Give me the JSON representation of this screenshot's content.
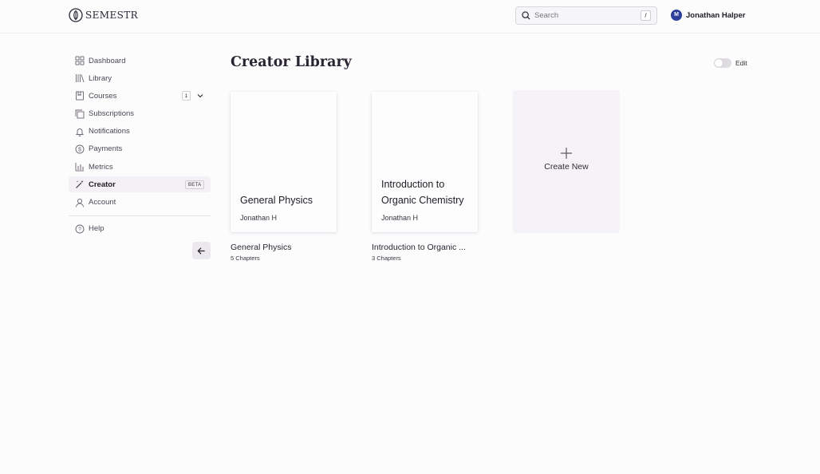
{
  "header": {
    "logo_text": "SEMESTR",
    "search": {
      "placeholder": "Search",
      "shortcut": "/"
    },
    "user": {
      "initial": "M",
      "name": "Jonathan Halper"
    }
  },
  "sidebar": {
    "items": [
      {
        "label": "Dashboard",
        "icon": "dashboard-icon"
      },
      {
        "label": "Library",
        "icon": "library-icon"
      },
      {
        "label": "Courses",
        "icon": "courses-icon",
        "count": "1"
      },
      {
        "label": "Subscriptions",
        "icon": "subscriptions-icon"
      },
      {
        "label": "Notifications",
        "icon": "bell-icon"
      },
      {
        "label": "Payments",
        "icon": "dollar-icon"
      },
      {
        "label": "Metrics",
        "icon": "bar-chart-icon"
      },
      {
        "label": "Creator",
        "icon": "magic-wand-icon",
        "badge": "BETA",
        "active": true
      },
      {
        "label": "Account",
        "icon": "user-icon"
      }
    ],
    "help": {
      "label": "Help",
      "icon": "help-icon"
    }
  },
  "main": {
    "title": "Creator Library",
    "edit_label": "Edit",
    "cards": [
      {
        "cover_title": "General Physics",
        "author": "Jonathan H",
        "caption": "General Physics",
        "chapters": "5 Chapters"
      },
      {
        "cover_title": "Introduction to Organic Chemistry",
        "author": "Jonathan H",
        "caption": "Introduction to Organic ...",
        "chapters": "3 Chapters"
      }
    ],
    "create_new_label": "Create New"
  },
  "colors": {
    "accent_avatar": "#2c3f9b",
    "background": "#fdfcfd",
    "create_tile": "#f5f3f7"
  }
}
